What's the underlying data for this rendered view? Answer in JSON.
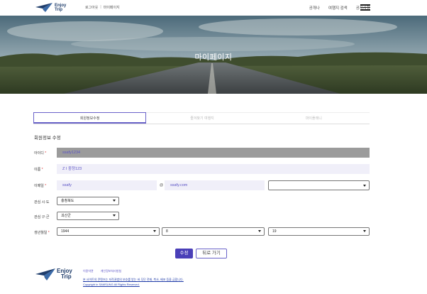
{
  "header": {
    "logo_text_line1": "Enjoy",
    "logo_text_line2": "Trip",
    "auth_links": [
      "로그아웃",
      "마이페이지"
    ],
    "auth_separator": "|",
    "nav": [
      "공개나",
      "여행지 검색",
      "공지사항"
    ]
  },
  "hero": {
    "title": "마이페이지"
  },
  "tabs": [
    {
      "label": "회원정보수정",
      "active": true
    },
    {
      "label": "즐겨찾기 여행지",
      "active": false
    },
    {
      "label": "마이플래니",
      "active": false
    }
  ],
  "form": {
    "section_title": "회원정보 수정",
    "id_label": "아이디",
    "id_value": "ssafy1234",
    "name_label": "이름",
    "name_value": "Z I 중정123",
    "email_label": "이메일",
    "email_local": "ssafy",
    "email_at": "@",
    "email_domain": "ssafy.com",
    "email_domain_select": "",
    "sido_label": "관심 시·도",
    "sido_value": "충청북도",
    "gugun_label": "관심 구·군",
    "gugun_value": "괴산군",
    "birth_label": "생년월일",
    "birth_year": "1944",
    "birth_month": "8",
    "birth_day": "19",
    "required_mark": "*"
  },
  "buttons": {
    "submit": "수정",
    "back": "뒤로 가기"
  },
  "footer": {
    "logo_line1": "Enjoy",
    "logo_line2": "Trip",
    "links": [
      "이용약관",
      "개인정보처리방침"
    ],
    "notice": "본 사이트의 콘텐츠는 저작권법의 보호를 받는 바 무단 전재, 복사, 배포 등을 금합니다.",
    "copyright": "Copyright in SAMSUNG All Rights Reserved."
  },
  "colors": {
    "accent": "#4a3fb8",
    "field_bg": "#f0eff9",
    "disabled_bg": "#9b9b9b",
    "brand_navy": "#1f3d6b"
  }
}
